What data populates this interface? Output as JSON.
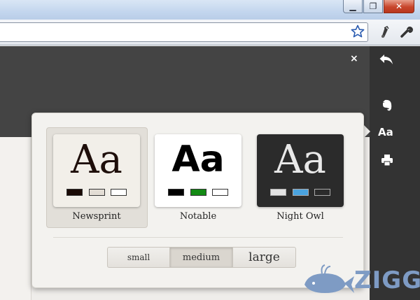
{
  "window": {
    "controls": {
      "minimize": "▁",
      "restore": "❐",
      "close": "✕"
    }
  },
  "toolbar": {
    "icons": [
      "star-icon",
      "evernote-clip-icon",
      "wrench-icon"
    ]
  },
  "page": {
    "close_label": "×"
  },
  "sidebar": {
    "font_label": "Aa",
    "icons": [
      "back-arrow-icon",
      "evernote-icon",
      "font-icon",
      "print-icon"
    ]
  },
  "popup": {
    "themes": [
      {
        "name": "Newsprint",
        "sample": "Aa",
        "selected": true,
        "background": "#f2efe9",
        "text_color": "#1e0e0a",
        "swatches": [
          "#1a0a06",
          "#e3ddd5",
          "#ffffff"
        ]
      },
      {
        "name": "Notable",
        "sample": "Aa",
        "selected": false,
        "background": "#ffffff",
        "text_color": "#000000",
        "swatches": [
          "#000000",
          "#138a14",
          "#ffffff"
        ]
      },
      {
        "name": "Night Owl",
        "sample": "Aa",
        "selected": false,
        "background": "#2b2b2b",
        "text_color": "#e8e8e8",
        "swatches": [
          "#e3e3e3",
          "#4aa3df",
          "#2b2b2b"
        ]
      }
    ],
    "sizes": [
      {
        "label": "small",
        "active": false
      },
      {
        "label": "medium",
        "active": true
      },
      {
        "label": "large",
        "active": false
      }
    ]
  },
  "watermark": {
    "text": "ZIGG",
    "color": "#7e9bc4"
  },
  "colors": {
    "page_dark": "#444444",
    "sidebar": "#333333",
    "popup_bg": "#f3f2ef"
  }
}
